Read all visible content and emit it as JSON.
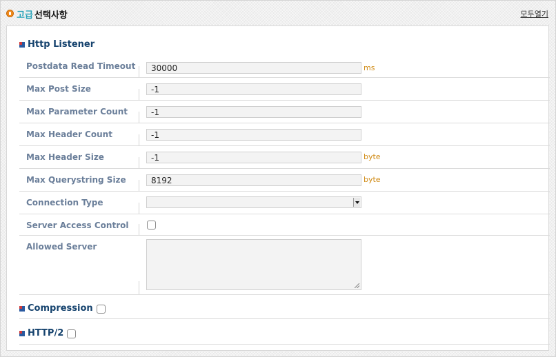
{
  "header": {
    "title_accent": "고급",
    "title_main": "선택사항",
    "expand_all": "모두열기"
  },
  "http_listener": {
    "title": "Http Listener",
    "rows": [
      {
        "label": "Postdata Read Timeout",
        "value": "30000",
        "unit": "ms"
      },
      {
        "label": "Max Post Size",
        "value": "-1",
        "unit": ""
      },
      {
        "label": "Max Parameter Count",
        "value": "-1",
        "unit": ""
      },
      {
        "label": "Max Header Count",
        "value": "-1",
        "unit": ""
      },
      {
        "label": "Max Header Size",
        "value": "-1",
        "unit": "byte"
      },
      {
        "label": "Max Querystring Size",
        "value": "8192",
        "unit": "byte"
      }
    ],
    "connection_type": {
      "label": "Connection Type",
      "value": ""
    },
    "server_access_control": {
      "label": "Server Access Control",
      "checked": false
    },
    "allowed_server": {
      "label": "Allowed Server",
      "value": ""
    }
  },
  "compression": {
    "title": "Compression",
    "checked": false
  },
  "http2": {
    "title": "HTTP/2",
    "checked": false
  },
  "colors": {
    "section_title": "#16436e",
    "label": "#6b7f9a",
    "unit": "#d08b15",
    "accent": "#29a3b9"
  }
}
